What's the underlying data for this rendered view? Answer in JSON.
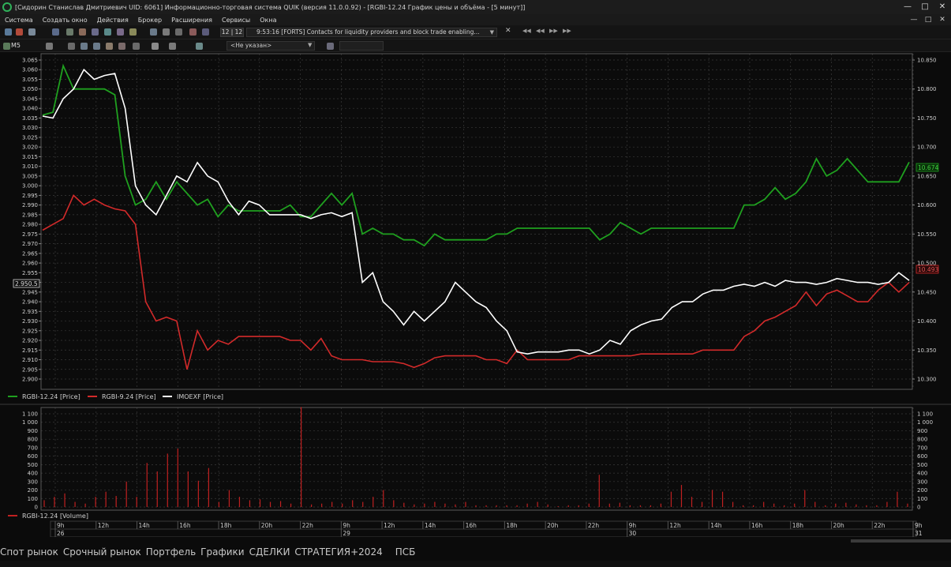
{
  "window": {
    "title": "[Сидорин Станислав Дмитриевич UID: 6061] Информационно-торговая система QUIK (версия 11.0.0.92) - [RGBI-12.24 График цены и объёма - [5 минут]]",
    "controls": [
      "—",
      "□",
      "✕"
    ]
  },
  "menu": {
    "items": [
      "Система",
      "Создать окно",
      "Действия",
      "Брокер",
      "Расширения",
      "Сервисы",
      "Окна"
    ],
    "controls": [
      "—",
      "□",
      "✕"
    ]
  },
  "toolbar": {
    "news_counter": "12 | 12",
    "news_text": "9:53:16  [FORTS] Contacts for liquidity providers and block trade enabling...",
    "interval": "M5",
    "instrument_placeholder": "<Не указан>"
  },
  "price_chart": {
    "left_axis_ticks": [
      "3.065",
      "3.060",
      "3.055",
      "3.050",
      "3.045",
      "3.040",
      "3.035",
      "3.030",
      "3.025",
      "3.020",
      "3.015",
      "3.010",
      "3.005",
      "3.000",
      "2.995",
      "2.990",
      "2.985",
      "2.980",
      "2.975",
      "2.970",
      "2.965",
      "2.960",
      "2.955",
      "2.950",
      "2.945",
      "2.940",
      "2.935",
      "2.930",
      "2.925",
      "2.920",
      "2.915",
      "2.910",
      "2.905",
      "2.900"
    ],
    "right_axis_ticks": [
      "10.850",
      "10.800",
      "10.750",
      "10.700",
      "10.650",
      "10.600",
      "10.550",
      "10.500",
      "10.450",
      "10.400",
      "10.350",
      "10.300"
    ],
    "current_left_label": "2.950.5",
    "current_green_label": "10.674",
    "current_red_label": "10.493",
    "legend": [
      {
        "name": "RGBI-12.24 [Price]",
        "color": "#1fa01f"
      },
      {
        "name": "RGBI-9.24 [Price]",
        "color": "#d22a2a"
      },
      {
        "name": "IMOEXF [Price]",
        "color": "#ffffff"
      }
    ]
  },
  "volume_chart": {
    "axis_ticks": [
      "1 100",
      "1 000",
      "900",
      "800",
      "700",
      "600",
      "500",
      "400",
      "300",
      "200",
      "100",
      "0"
    ],
    "legend": "RGBI-12.24 [Volume]",
    "legend_color": "#c02020"
  },
  "time_axis": {
    "hours": [
      "9h",
      "12h",
      "14h",
      "16h",
      "18h",
      "20h",
      "22h",
      "9h",
      "12h",
      "14h",
      "16h",
      "18h",
      "20h",
      "22h",
      "9h",
      "12h",
      "14h",
      "16h",
      "18h",
      "20h",
      "22h",
      "9h"
    ],
    "days": [
      "26",
      "29",
      "30",
      "31"
    ]
  },
  "bottom_tabs": [
    "Спот рынок",
    "Срочный рынок",
    "Портфель",
    "Графики",
    "СДЕЛКИ",
    "СТРАТЕГИЯ+2024",
    "ПСБ"
  ],
  "chart_data": {
    "type": "line",
    "title": "",
    "series": [
      {
        "name": "RGBI-12.24 [Price]",
        "axis": "right",
        "color": "#1fa01f",
        "values": [
          10.755,
          10.76,
          10.84,
          10.8,
          10.8,
          10.8,
          10.8,
          10.79,
          10.65,
          10.6,
          10.61,
          10.64,
          10.61,
          10.64,
          10.62,
          10.6,
          10.61,
          10.58,
          10.6,
          10.59,
          10.59,
          10.59,
          10.59,
          10.59,
          10.6,
          10.58,
          10.58,
          10.6,
          10.62,
          10.6,
          10.62,
          10.55,
          10.56,
          10.55,
          10.55,
          10.54,
          10.54,
          10.53,
          10.55,
          10.54,
          10.54,
          10.54,
          10.54,
          10.54,
          10.55,
          10.55,
          10.56,
          10.56,
          10.56,
          10.56,
          10.56,
          10.56,
          10.56,
          10.56,
          10.54,
          10.55,
          10.57,
          10.56,
          10.55,
          10.56,
          10.56,
          10.56,
          10.56,
          10.56,
          10.56,
          10.56,
          10.56,
          10.56,
          10.6,
          10.6,
          10.61,
          10.63,
          10.61,
          10.62,
          10.64,
          10.68,
          10.65,
          10.66,
          10.68,
          10.66,
          10.64,
          10.64,
          10.64,
          10.64,
          10.674
        ]
      },
      {
        "name": "RGBI-9.24 [Price]",
        "axis": "left",
        "color": "#d22a2a",
        "values": [
          2.977,
          2.98,
          2.983,
          2.995,
          2.99,
          2.993,
          2.99,
          2.988,
          2.987,
          2.98,
          2.94,
          2.93,
          2.932,
          2.93,
          2.905,
          2.925,
          2.915,
          2.92,
          2.918,
          2.922,
          2.922,
          2.922,
          2.922,
          2.922,
          2.92,
          2.92,
          2.915,
          2.921,
          2.912,
          2.91,
          2.91,
          2.91,
          2.909,
          2.909,
          2.909,
          2.908,
          2.906,
          2.908,
          2.911,
          2.912,
          2.912,
          2.912,
          2.912,
          2.91,
          2.91,
          2.908,
          2.915,
          2.91,
          2.91,
          2.91,
          2.91,
          2.91,
          2.912,
          2.912,
          2.912,
          2.912,
          2.912,
          2.912,
          2.913,
          2.913,
          2.913,
          2.913,
          2.913,
          2.913,
          2.915,
          2.915,
          2.915,
          2.915,
          2.922,
          2.925,
          2.93,
          2.932,
          2.935,
          2.938,
          2.945,
          2.938,
          2.944,
          2.946,
          2.943,
          2.94,
          2.94,
          2.946,
          2.95,
          2.945,
          2.95
        ]
      },
      {
        "name": "IMOEXF [Price]",
        "axis": "left",
        "color": "#ffffff",
        "values": [
          3.036,
          3.035,
          3.045,
          3.05,
          3.06,
          3.055,
          3.057,
          3.058,
          3.04,
          3.0,
          2.99,
          2.985,
          2.995,
          3.005,
          3.002,
          3.012,
          3.005,
          3.002,
          2.992,
          2.985,
          2.992,
          2.99,
          2.985,
          2.985,
          2.985,
          2.985,
          2.983,
          2.985,
          2.986,
          2.984,
          2.986,
          2.95,
          2.955,
          2.94,
          2.935,
          2.928,
          2.935,
          2.93,
          2.935,
          2.94,
          2.95,
          2.945,
          2.94,
          2.937,
          2.93,
          2.925,
          2.914,
          2.913,
          2.914,
          2.914,
          2.914,
          2.915,
          2.915,
          2.913,
          2.915,
          2.92,
          2.918,
          2.925,
          2.928,
          2.93,
          2.931,
          2.937,
          2.94,
          2.94,
          2.944,
          2.946,
          2.946,
          2.948,
          2.949,
          2.948,
          2.95,
          2.948,
          2.951,
          2.95,
          2.95,
          2.949,
          2.95,
          2.952,
          2.951,
          2.95,
          2.95,
          2.949,
          2.95,
          2.955,
          2.951
        ]
      }
    ],
    "volume": {
      "name": "RGBI-12.24 [Volume]",
      "values": [
        80,
        120,
        160,
        60,
        40,
        120,
        180,
        130,
        300,
        120,
        520,
        420,
        630,
        690,
        420,
        310,
        460,
        60,
        200,
        120,
        80,
        90,
        60,
        70,
        40,
        1180,
        30,
        40,
        60,
        40,
        80,
        60,
        120,
        200,
        80,
        50,
        30,
        40,
        60,
        40,
        30,
        60,
        20,
        20,
        20,
        20,
        20,
        40,
        60,
        30,
        10,
        20,
        20,
        40,
        380,
        40,
        50,
        20,
        20,
        20,
        40,
        180,
        260,
        120,
        60,
        200,
        180,
        60,
        20,
        20,
        60,
        40,
        20,
        40,
        200,
        60,
        20,
        40,
        50,
        30,
        20,
        20,
        60,
        180,
        40
      ]
    },
    "left_ylim": [
      2.9,
      3.065
    ],
    "right_ylim": [
      10.3,
      10.85
    ],
    "volume_ylim": [
      0,
      1100
    ]
  }
}
